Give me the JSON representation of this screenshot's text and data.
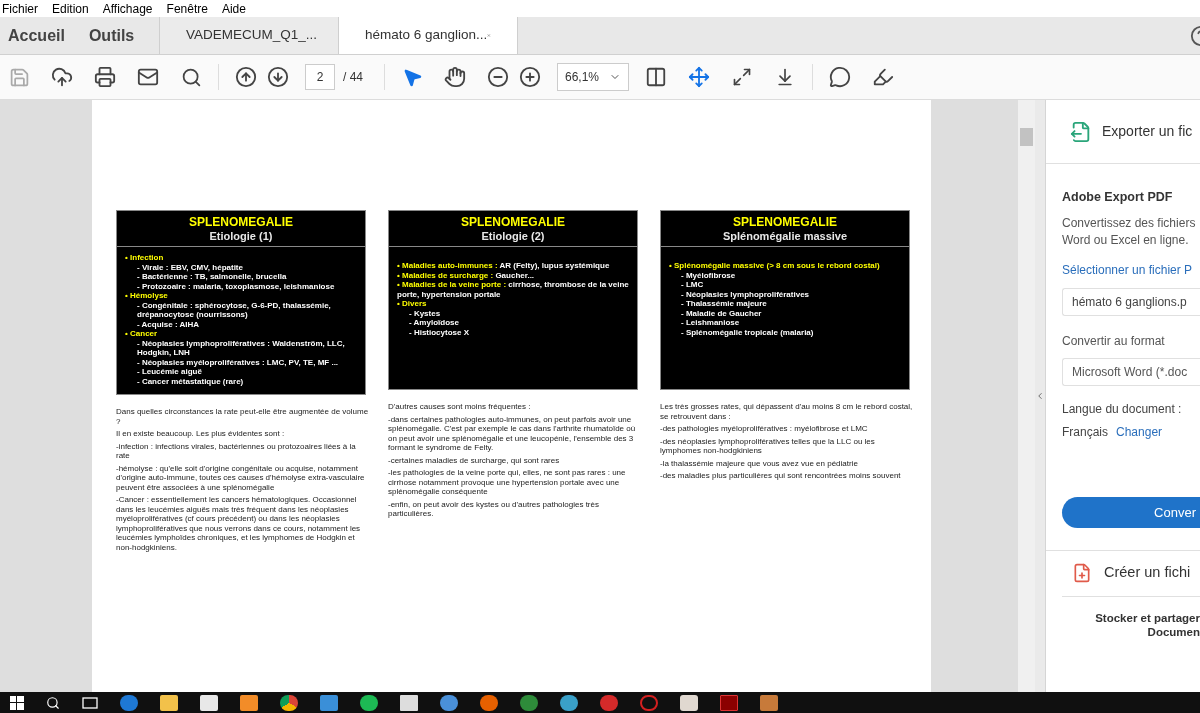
{
  "menu": [
    "Fichier",
    "Edition",
    "Affichage",
    "Fenêtre",
    "Aide"
  ],
  "nav_tabs": [
    {
      "label": "Accueil"
    },
    {
      "label": "Outils"
    }
  ],
  "document_tabs": [
    {
      "label": "VADEMECUM_Q1_...",
      "selected": false
    },
    {
      "label": "hémato 6 ganglion...",
      "selected": true
    }
  ],
  "toolbar": {
    "page_field": "2",
    "page_total": "/ 44",
    "zoom": "66,1%"
  },
  "slides": [
    {
      "title": "SPLENOMEGALIE",
      "subtitle": "Etiologie (1)",
      "bullets": [
        {
          "label": "• Infection",
          "children": [
            "- Virale : EBV, CMV, hépatite",
            "- Bactérienne : TB, salmonelle, brucella",
            "- Protozoaire : malaria, toxoplasmose, leishmaniose"
          ]
        },
        {
          "label": "• Hémolyse",
          "children": [
            "- Congénitale : sphérocytose, G-6-PD, thalassémie, drépanocytose (nourrissons)",
            "- Acquise : AIHA"
          ]
        },
        {
          "label": "• Cancer",
          "children": [
            "- Néoplasies lymphoprolifératives : Waldenström, LLC, Hodgkin, LNH",
            "- Néoplasies myéloprolifératives : LMC, PV, TE, MF ...",
            "- Leucémie aiguë",
            "- Cancer métastatique (rare)"
          ]
        }
      ],
      "notes": [
        "Dans quelles circonstances la rate peut-elle être augmentée de volume ?",
        "Il en existe beaucoup. Les plus évidentes sont :",
        "-infection : infections virales, bactériennes ou protozoaires liées à la rate",
        "-hémolyse : qu'elle soit d'origine congénitale ou acquise, notamment d'origine auto-immune, toutes ces causes d'hémolyse extra-vasculaire peuvent être associées à une splénomégalie",
        "-Cancer : essentiellement les cancers hématologiques. Occasionnel dans les leucémies aiguës mais très fréquent dans les néoplasies myéloprolifératives (cf cours précédent) ou dans les néoplasies lymphoprolifératives que nous verrons dans ce cours, notamment les leucémies lymphoïdes chroniques, et les lymphomes de Hodgkin et non-hodgkiniens."
      ]
    },
    {
      "title": "SPLENOMEGALIE",
      "subtitle": "Etiologie (2)",
      "bullets": [
        {
          "label": "• Maladies auto-immunes :",
          "detail": "AR (Felty), lupus systémique"
        },
        {
          "label": "• Maladies de surcharge :",
          "detail": "Gaucher..."
        },
        {
          "label": "• Maladies de la veine porte :",
          "detail": "cirrhose, thrombose de la veine porte, hypertension portale"
        },
        {
          "label": "• Divers",
          "children": [
            "- Kystes",
            "- Amyloïdose",
            "- Histiocytose X"
          ]
        }
      ],
      "notes": [
        "D'autres causes sont moins fréquentes :",
        "-dans certaines pathologies auto-immunes, on peut parfois avoir une splénomégalie. C'est par exemple le cas dans l'arthrite rhumatoïde où on peut avoir une splénomégalie et une leucopénie, l'ensemble des 3 formant le syndrome de Felty.",
        "-certaines maladies de surcharge, qui sont rares",
        "-les pathologies de la veine porte qui, elles, ne sont pas rares : une cirrhose notamment provoque une hypertension portale avec une splénomégalie conséquente",
        "-enfin, on peut avoir des kystes ou d'autres pathologies très particulières."
      ]
    },
    {
      "title": "SPLENOMEGALIE",
      "subtitle": "Splénomégalie massive",
      "bullets": [
        {
          "label": "• Splénomégalie massive (> 8 cm sous le rebord costal)",
          "children": [
            "- Myélofibrose",
            "- LMC",
            "- Néoplasies lymphoprolifératives",
            "- Thalassémie majeure",
            "- Maladie de Gaucher",
            "- Leishmaniose",
            "- Splénomégalie tropicale (malaria)"
          ]
        }
      ],
      "notes": [
        "Les très grosses rates, qui dépassent d'au moins 8 cm le rebord costal, se retrouvent dans :",
        "-des pathologies myéloprolifératives : myélofibrose et LMC",
        "-des néoplasies lymphoprolifératives telles que la LLC ou les lymphomes non-hodgkiniens",
        "-la thalassémie majeure que vous avez vue en pédiatrie",
        "-des maladies plus particulières qui sont rencontrées moins souvent"
      ]
    }
  ],
  "panel": {
    "export_title": "Exporter un fic",
    "heading": "Adobe Export PDF",
    "description": [
      "Convertissez des fichiers",
      "Word ou Excel en ligne."
    ],
    "select_link": "Sélectionner un fichier P",
    "file_field": "hémato 6 ganglions.p",
    "format_label": "Convertir au format",
    "format_field": "Microsoft Word (*.doc",
    "language_label": "Langue du document :",
    "language_value": "Français",
    "change_link": "Changer",
    "convert_button": "Conver",
    "create_title": "Créer un fichi",
    "store_text": [
      "Stocker et partager",
      "Documen"
    ]
  }
}
